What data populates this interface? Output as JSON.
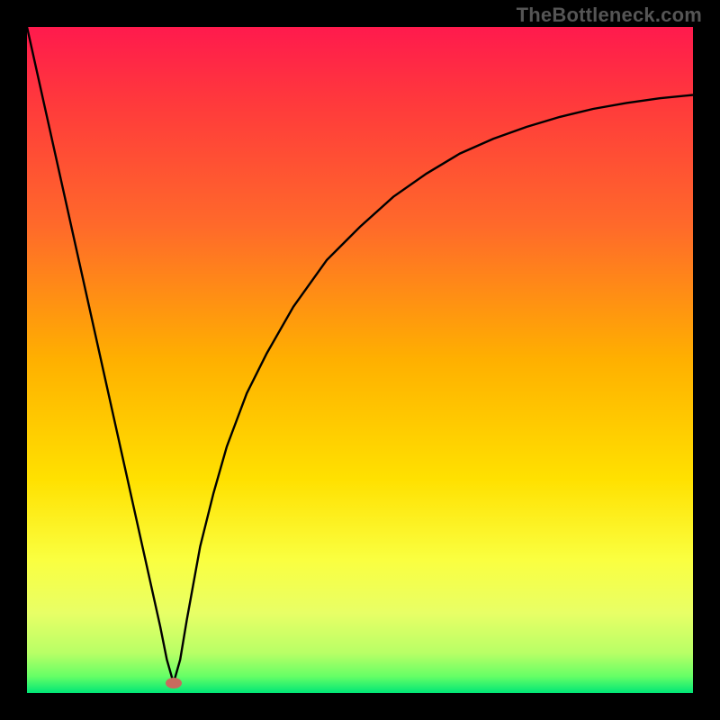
{
  "watermark": "TheBottleneck.com",
  "colors": {
    "frame": "#000000",
    "gradient_stops": [
      {
        "offset": 0.0,
        "color": "#ff1a4d"
      },
      {
        "offset": 0.12,
        "color": "#ff3b3b"
      },
      {
        "offset": 0.3,
        "color": "#ff6a2a"
      },
      {
        "offset": 0.5,
        "color": "#ffb000"
      },
      {
        "offset": 0.68,
        "color": "#ffe100"
      },
      {
        "offset": 0.8,
        "color": "#faff40"
      },
      {
        "offset": 0.88,
        "color": "#e8ff66"
      },
      {
        "offset": 0.94,
        "color": "#b8ff66"
      },
      {
        "offset": 0.975,
        "color": "#66ff66"
      },
      {
        "offset": 1.0,
        "color": "#00e676"
      }
    ],
    "curve": "#000000",
    "marker": "#c86a5e"
  },
  "chart_data": {
    "type": "line",
    "title": "",
    "xlabel": "",
    "ylabel": "",
    "xlim": [
      0,
      100
    ],
    "ylim": [
      0,
      100
    ],
    "grid": false,
    "legend": false,
    "notes": "Axes unlabeled; values are relative 0–100 read from pixel positions. y=0 at bottom (green). Single black curve descending steeply to a minimum near x≈22 then rising asymptotically toward ~90.",
    "series": [
      {
        "name": "curve",
        "x": [
          0,
          3,
          6,
          9,
          12,
          15,
          18,
          20,
          21,
          22,
          23,
          24,
          26,
          28,
          30,
          33,
          36,
          40,
          45,
          50,
          55,
          60,
          65,
          70,
          75,
          80,
          85,
          90,
          95,
          100
        ],
        "y": [
          100,
          86.5,
          73,
          59.5,
          46,
          32.5,
          19,
          10,
          5,
          1.5,
          5,
          11,
          22,
          30,
          37,
          45,
          51,
          58,
          65,
          70,
          74.5,
          78,
          81,
          83.2,
          85,
          86.5,
          87.7,
          88.6,
          89.3,
          89.8
        ]
      }
    ],
    "marker": {
      "x": 22,
      "y": 1.5
    }
  }
}
